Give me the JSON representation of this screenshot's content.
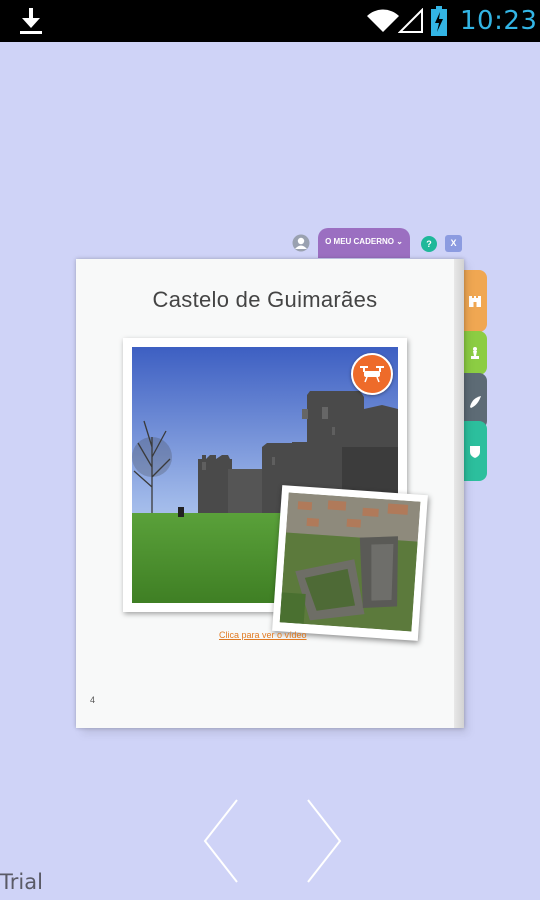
{
  "status_bar": {
    "time": "10:23",
    "icons": [
      "download-icon",
      "wifi-icon",
      "signal-icon",
      "battery-charging-icon"
    ]
  },
  "menu": {
    "caderno_label": "O MEU CADERNO ⌄",
    "help_label": "?",
    "close_label": "X"
  },
  "book": {
    "title": "Castelo de Guimarães",
    "video_link": "Clica para ver o vídeo",
    "page_number": "4"
  },
  "side_tabs": [
    "castle-icon",
    "chess-knight-icon",
    "quill-icon",
    "shield-icon"
  ],
  "watermark": "Trial",
  "colors": {
    "background": "#cfd3f7",
    "accent_time": "#33b5e5",
    "caderno": "#9b6fc1",
    "drone": "#ee6b2a",
    "link": "#e07a22"
  }
}
